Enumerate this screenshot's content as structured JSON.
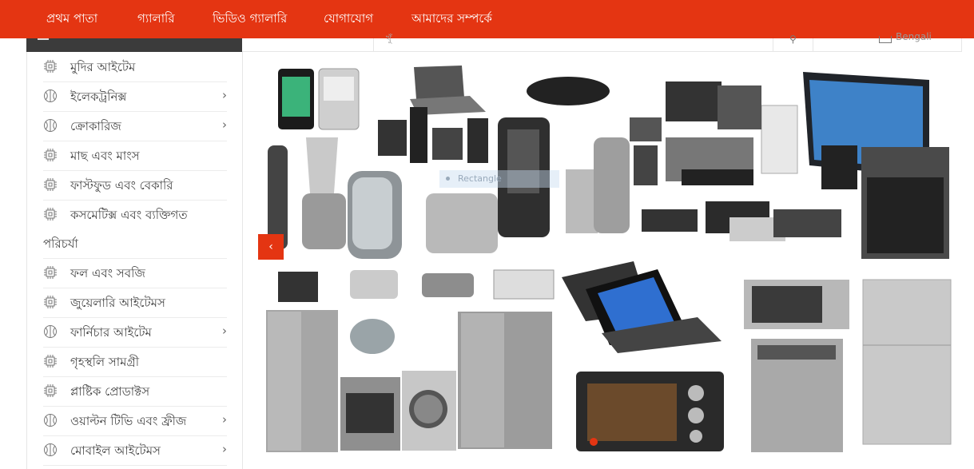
{
  "nav": {
    "items": [
      {
        "label": "প্রথম পাতা"
      },
      {
        "label": "গ্যালারি"
      },
      {
        "label": "ভিডিও গ্যালারি"
      },
      {
        "label": "যোগাযোগ"
      },
      {
        "label": "আমাদের সম্পর্কে"
      }
    ]
  },
  "search": {
    "placeholder": "খুঁ",
    "language": "Bengali"
  },
  "sidebar": {
    "items": [
      {
        "label": "মুদির আইটেম",
        "icon": "chip-icon",
        "submenu": false
      },
      {
        "label": "ইলেকট্রনিক্স",
        "icon": "ball-icon",
        "submenu": true
      },
      {
        "label": "ক্রোকারিজ",
        "icon": "ball-icon",
        "submenu": true
      },
      {
        "label": "মাছ এবং মাংস",
        "icon": "chip-icon",
        "submenu": false
      },
      {
        "label": "ফাস্টফুড এবং বেকারি",
        "icon": "chip-icon",
        "submenu": false
      },
      {
        "label": "কসমেটিক্স এবং ব্যক্তিগত",
        "label2": "পরিচর্যা",
        "icon": "chip-icon",
        "submenu": false
      },
      {
        "label": "ফল এবং সবজি",
        "icon": "chip-icon",
        "submenu": false
      },
      {
        "label": "জুয়েলারি আইটেমস",
        "icon": "chip-icon",
        "submenu": false
      },
      {
        "label": "ফার্নিচার আইটেম",
        "icon": "ball-icon",
        "submenu": true
      },
      {
        "label": "গৃহস্থলি সামগ্রী",
        "icon": "chip-icon",
        "submenu": false
      },
      {
        "label": "প্লাষ্টিক প্রোডাক্টস",
        "icon": "chip-icon",
        "submenu": false
      },
      {
        "label": "ওয়াল্টন টিভি এবং ফ্রীজ",
        "icon": "ball-icon",
        "submenu": true
      },
      {
        "label": "মোবাইল আইটেমস",
        "icon": "ball-icon",
        "submenu": true
      }
    ]
  },
  "slider": {
    "overlay_text": "Rectangle",
    "prev_icon": "chevron-left-icon",
    "active_slide": 1
  },
  "colors": {
    "brand": "#e43512",
    "dark": "#3b3b3b"
  }
}
